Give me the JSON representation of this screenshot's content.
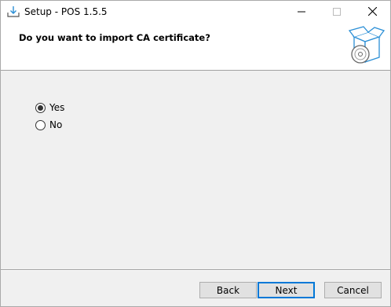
{
  "window": {
    "title": "Setup - POS 1.5.5"
  },
  "titlebar": {
    "minimize_icon": "minimize-icon",
    "maximize_icon": "maximize-icon",
    "close_icon": "close-icon"
  },
  "header": {
    "question": "Do you want to import CA certificate?",
    "art_icon": "installer-box-disc-icon"
  },
  "options": {
    "yes_label": "Yes",
    "no_label": "No",
    "selected": "Yes"
  },
  "footer": {
    "back_label": "Back",
    "next_label": "Next",
    "cancel_label": "Cancel"
  },
  "colors": {
    "focus_border": "#0078d7",
    "art_blue": "#2b8fd6"
  }
}
